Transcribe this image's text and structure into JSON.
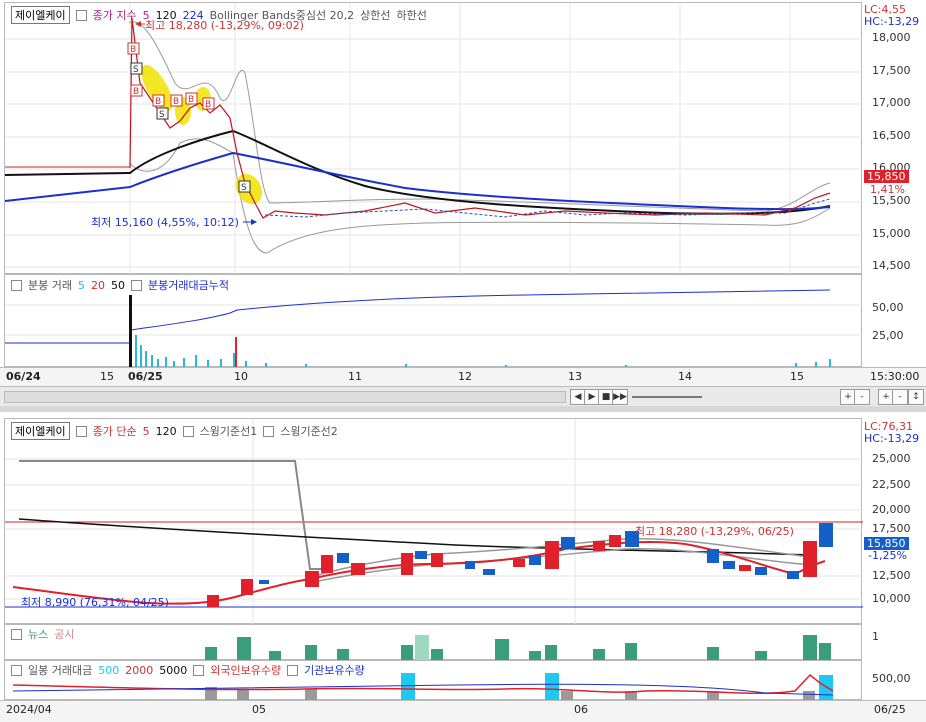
{
  "top": {
    "legend": {
      "symbol": "제이엘케이",
      "ma_label": "종가 지수",
      "ma_periods": [
        "5",
        "120",
        "224"
      ],
      "bollinger": "Bollinger Bands중심선 20,2",
      "upper": "상한선",
      "lower": "하한선"
    },
    "high_note": "최고 18,280 (-13,29%, 09:02)",
    "low_note": "최저 15,160 (4,55%, 10:12)",
    "lc": "LC:4,55",
    "hc": "HC:-13,29",
    "price_badge": "15,850",
    "change_badge": "1,41%",
    "y_ticks": [
      "18,000",
      "17,500",
      "17,000",
      "16,500",
      "16,000",
      "15,500",
      "15,000",
      "14,500"
    ],
    "volume": {
      "legend_label": "분봉 거래",
      "periods": [
        "5",
        "20",
        "50"
      ],
      "cumulative_label": "분봉거래대금누적",
      "y_ticks": [
        "50,00",
        "25,00"
      ]
    },
    "x_labels": [
      "06/24",
      "15",
      "06/25",
      "10",
      "11",
      "12",
      "13",
      "14",
      "15"
    ],
    "time_label": "15:30:00"
  },
  "toolbar": {
    "buttons": [
      "◀",
      "▶",
      "■",
      "▶▶",
      "+",
      "-",
      "+",
      "-",
      "↕"
    ]
  },
  "bottom": {
    "legend": {
      "symbol": "제이엘케이",
      "ma_label": "종가 단순",
      "ma_periods": [
        "5",
        "120"
      ],
      "swing1": "스윙기준선1",
      "swing2": "스윙기준선2"
    },
    "lc": "LC:76,31",
    "hc": "HC:-13,29",
    "price_badge": "15,850",
    "change_badge": "-1,25%",
    "high_note": "최고 18,280 (-13,29%, 06/25)",
    "low_note": "최저 8,990 (76,31%, 04/25)",
    "y_ticks": [
      "25,000",
      "22,500",
      "20,000",
      "17,500",
      "12,500",
      "10,000"
    ],
    "news": {
      "label": "뉴스",
      "label2": "공시",
      "y_tick": "1"
    },
    "volume": {
      "legend_label": "일봉 거래대금",
      "periods": [
        "500",
        "2000",
        "5000"
      ],
      "foreign": "외국인보유수량",
      "inst": "기관보유수량",
      "y_tick": "500,00"
    },
    "x_labels": [
      "2024/04",
      "05",
      "06"
    ],
    "end_label": "06/25"
  },
  "colors": {
    "up": "#e0202a",
    "down": "#1560c8",
    "ma_black": "#111111",
    "ma_blue": "#1a2fd0",
    "news": "#3a9e7a"
  }
}
